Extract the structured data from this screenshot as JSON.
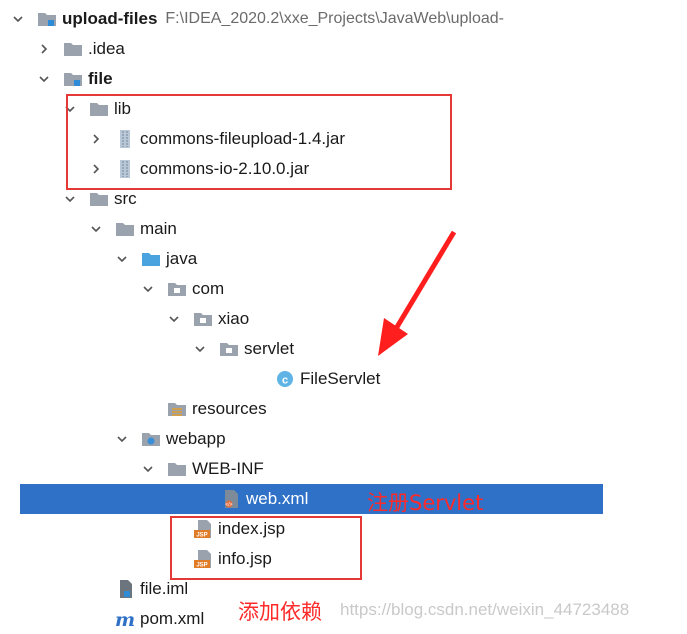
{
  "project": {
    "name": "upload-files",
    "path": "F:\\IDEA_2020.2\\xxe_Projects\\JavaWeb\\upload-"
  },
  "tree": [
    {
      "label": "upload-files",
      "type": "module",
      "expanded": true
    },
    {
      "label": ".idea",
      "type": "folder"
    },
    {
      "label": "file",
      "type": "module"
    },
    {
      "label": "lib",
      "type": "folder"
    },
    {
      "label": "commons-fileupload-1.4.jar",
      "type": "jar"
    },
    {
      "label": "commons-io-2.10.0.jar",
      "type": "jar"
    },
    {
      "label": "src",
      "type": "folder"
    },
    {
      "label": "main",
      "type": "folder"
    },
    {
      "label": "java",
      "type": "source-folder"
    },
    {
      "label": "com",
      "type": "package"
    },
    {
      "label": "xiao",
      "type": "package"
    },
    {
      "label": "servlet",
      "type": "package"
    },
    {
      "label": "FileServlet",
      "type": "class"
    },
    {
      "label": "resources",
      "type": "resources-folder"
    },
    {
      "label": "webapp",
      "type": "web-folder"
    },
    {
      "label": "WEB-INF",
      "type": "folder"
    },
    {
      "label": "web.xml",
      "type": "xml",
      "selected": true
    },
    {
      "label": "index.jsp",
      "type": "jsp"
    },
    {
      "label": "info.jsp",
      "type": "jsp"
    },
    {
      "label": "file.iml",
      "type": "iml"
    },
    {
      "label": "pom.xml",
      "type": "maven"
    }
  ],
  "annotations": {
    "register_servlet": "注册Servlet",
    "add_dependency": "添加依赖"
  },
  "watermark": "https://blog.csdn.net/weixin_44723488",
  "colors": {
    "selection": "#2e71c7",
    "annotation": "#e53935",
    "folder": "#a0a8b4",
    "source_folder": "#4aa3df"
  }
}
